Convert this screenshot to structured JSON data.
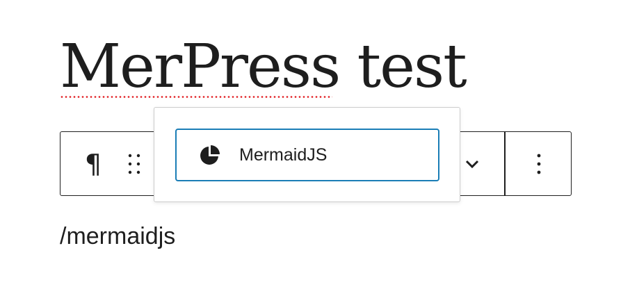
{
  "title": "MerPress test",
  "toolbar": {
    "paragraph_icon": "¶",
    "paragraph_icon_name": "pilcrow-icon",
    "drag_icon_name": "drag-handle-icon",
    "chevron_icon_name": "chevron-down-icon",
    "more_icon_name": "more-vertical-icon"
  },
  "autocomplete": {
    "options": [
      {
        "label": "MermaidJS",
        "icon": "pie-chart-icon"
      }
    ],
    "selected_border_color": "#1a7db6"
  },
  "paragraph": {
    "text": "/mermaidjs"
  },
  "colors": {
    "text": "#1e1e1e",
    "spellcheck_underline": "#e2262a"
  }
}
